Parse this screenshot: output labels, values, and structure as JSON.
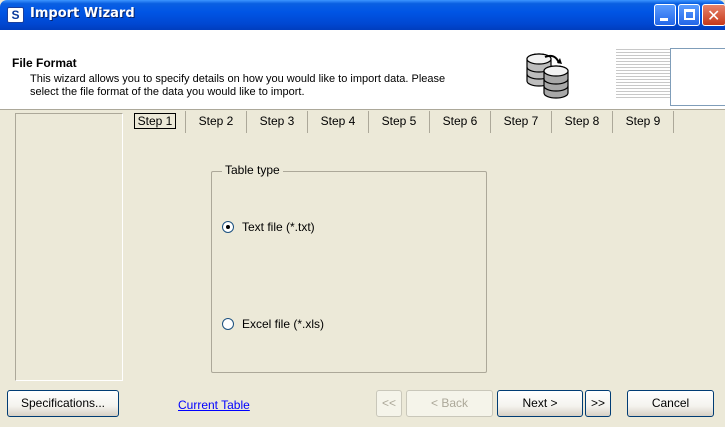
{
  "window": {
    "title": "Import Wizard",
    "icon": "app-icon",
    "app_icon_glyph": "S"
  },
  "header": {
    "title": "File Format",
    "description": "This wizard allows you to specify details on how you would like to import data. Please select the file format of the data you would like to import.",
    "icon": "database-icon"
  },
  "tabs": [
    {
      "label": "Step 1",
      "active": true
    },
    {
      "label": "Step 2"
    },
    {
      "label": "Step 3"
    },
    {
      "label": "Step 4"
    },
    {
      "label": "Step 5"
    },
    {
      "label": "Step 6"
    },
    {
      "label": "Step 7"
    },
    {
      "label": "Step 8"
    },
    {
      "label": "Step 9"
    }
  ],
  "table_type": {
    "label": "Table type",
    "options": [
      {
        "label": "Text file (*.txt)",
        "selected": true
      },
      {
        "label": "Excel file (*.xls)",
        "selected": false
      }
    ]
  },
  "footer": {
    "specifications_label": "Specifications...",
    "current_table_link": "Current Table",
    "first_label": "<<",
    "back_label": "< Back",
    "next_label": "Next >",
    "last_label": ">>",
    "cancel_label": "Cancel"
  },
  "colors": {
    "titlebar": "#0055e5",
    "window_bg": "#ece9d8",
    "link": "#0000ff"
  }
}
